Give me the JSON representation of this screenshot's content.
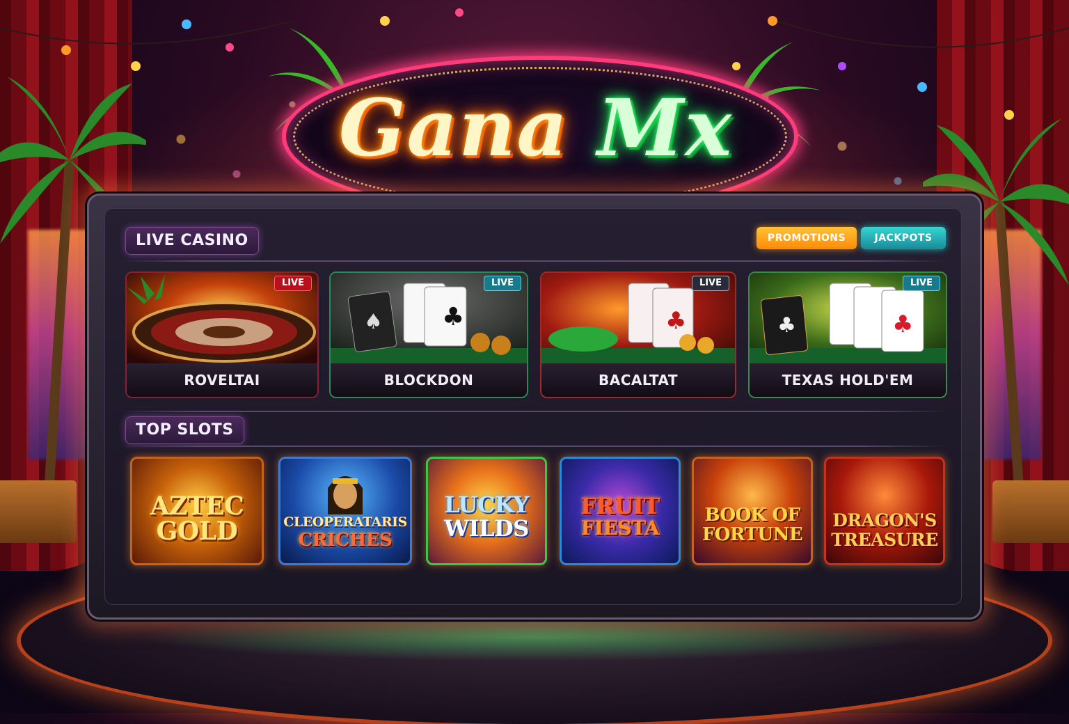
{
  "brand": {
    "logo_part1": "Gana",
    "logo_part2": "Mx"
  },
  "sections": {
    "live_casino": "LIVE CASINO",
    "top_slots": "TOP SLOTS"
  },
  "nav": {
    "promotions": "PROMOTIONS",
    "jackpots": "JACKPOTS"
  },
  "live_games": [
    {
      "name": "ROVELTAI",
      "badge": "LIVE",
      "banner": ""
    },
    {
      "name": "BLOCKDON",
      "badge": "LIVE",
      "banner": ""
    },
    {
      "name": "BACALTAT",
      "badge": "LIVE",
      "banner": ""
    },
    {
      "name": "TEXAS HOLD'EM",
      "badge": "LIVE",
      "banner": ""
    }
  ],
  "slots": [
    {
      "line1": "AZTEC",
      "line2": "GOLD"
    },
    {
      "line1": "CLEOPERATARIS",
      "line2": "CRICHES"
    },
    {
      "line1": "LUCKY",
      "line2": "WILDS"
    },
    {
      "line1": "FRUIT",
      "line2": "FIESTA"
    },
    {
      "line1": "BOOK OF",
      "line2": "FORTUNE"
    },
    {
      "line1": "DRAGON'S",
      "line2": "TREASURE"
    }
  ],
  "colors": {
    "neon_pink": "#ff3b7a",
    "neon_orange": "#ff7a00",
    "neon_green": "#18e050",
    "promo": "#ffb020",
    "jackpot": "#2cc8c4"
  }
}
